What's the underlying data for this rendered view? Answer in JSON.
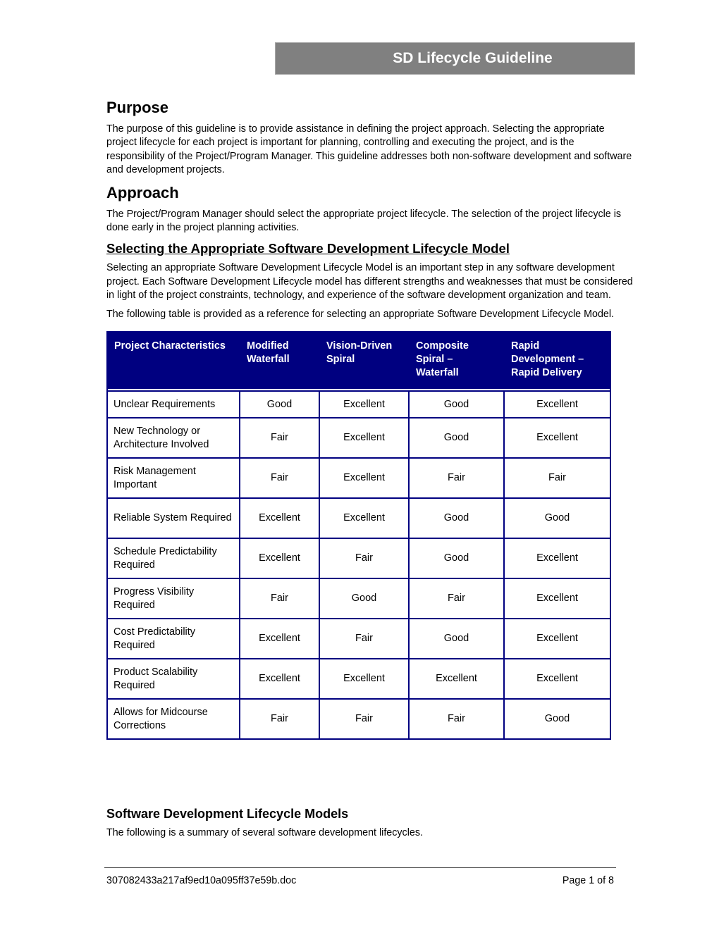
{
  "header": {
    "title": "SD Lifecycle Guideline",
    "title_bg_color": "#808080"
  },
  "purpose": {
    "heading": "Purpose",
    "body": "The purpose of this guideline is to provide assistance in defining the project approach. Selecting the appropriate project lifecycle for each project is important for planning, controlling and executing the project, and is the responsibility of the Project/Program Manager. This guideline addresses both non-software development and software and development projects."
  },
  "approach": {
    "heading": "Approach",
    "body": "The Project/Program Manager should select the appropriate project lifecycle. The selection of the project lifecycle is done early in the project planning activities."
  },
  "selecting": {
    "heading": "Selecting the Appropriate Software Development Lifecycle Model",
    "body1": "Selecting an appropriate Software Development Lifecycle Model is an important step in any software development project. Each Software Development Lifecycle model has different strengths and weaknesses that must be considered in light of the project constraints, technology, and experience of the software development organization and team.",
    "body2": "The following table is provided as a reference for selecting an appropriate Software Development Lifecycle Model."
  },
  "table": {
    "header_color": "#000080",
    "columns": [
      "Project Characteristics",
      "Modified Waterfall",
      "Vision-Driven Spiral",
      "Composite Spiral – Waterfall",
      "Rapid Development – Rapid Delivery"
    ],
    "rows": [
      {
        "characteristic": "Unclear Requirements",
        "values": [
          "Good",
          "Excellent",
          "Good",
          "Excellent"
        ]
      },
      {
        "characteristic": "New Technology or Architecture Involved",
        "values": [
          "Fair",
          "Excellent",
          "Good",
          "Excellent"
        ]
      },
      {
        "characteristic": "Risk Management Important",
        "values": [
          "Fair",
          "Excellent",
          "Fair",
          "Fair"
        ]
      },
      {
        "characteristic": "Reliable System Required",
        "values": [
          "Excellent",
          "Excellent",
          "Good",
          "Good"
        ]
      },
      {
        "characteristic": "Schedule Predictability Required",
        "values": [
          "Excellent",
          "Fair",
          "Good",
          "Excellent"
        ]
      },
      {
        "characteristic": "Progress Visibility Required",
        "values": [
          "Fair",
          "Good",
          "Fair",
          "Excellent"
        ]
      },
      {
        "characteristic": "Cost Predictability Required",
        "values": [
          "Excellent",
          "Fair",
          "Good",
          "Excellent"
        ]
      },
      {
        "characteristic": "Product Scalability Required",
        "values": [
          "Excellent",
          "Excellent",
          "Excellent",
          "Excellent"
        ]
      },
      {
        "characteristic": "Allows for Midcourse Corrections",
        "values": [
          "Fair",
          "Fair",
          "Fair",
          "Good"
        ]
      }
    ]
  },
  "models": {
    "heading": "Software Development Lifecycle Models",
    "body": "The following is a summary of several software development lifecycles."
  },
  "footer": {
    "filename": "307082433a217af9ed10a095ff37e59b.doc",
    "page": "Page 1 of 8"
  }
}
